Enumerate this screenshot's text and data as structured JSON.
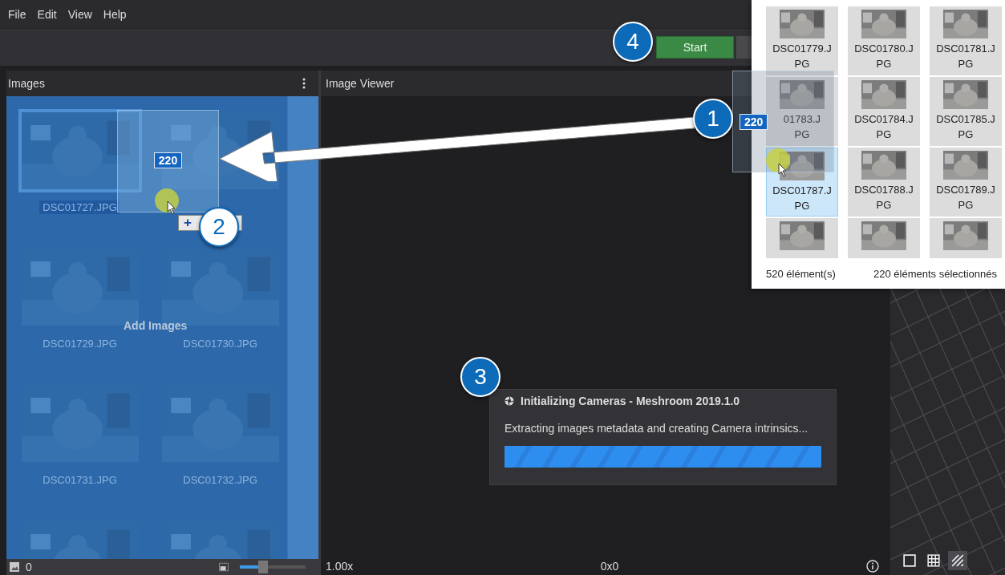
{
  "menu": [
    "File",
    "Edit",
    "View",
    "Help"
  ],
  "toolbar": {
    "start_button": "Start"
  },
  "images_panel": {
    "title": "Images",
    "drop_hint": "Add Images",
    "thumbnails": [
      {
        "label": "DSC01727.JPG",
        "selected": true
      },
      {
        "selected": false
      },
      {
        "label": "DSC01729.JPG",
        "selected": false
      },
      {
        "label": "DSC01730.JPG",
        "selected": false
      },
      {
        "label": "DSC01731.JPG",
        "selected": false
      },
      {
        "label": "DSC01732.JPG",
        "selected": false
      },
      {
        "selected": false
      },
      {
        "selected": false
      }
    ],
    "image_count": "0",
    "thumbnail_size": {
      "level": 0.35
    }
  },
  "drag_ghost": {
    "count": "220",
    "drop_symbol": "+"
  },
  "image_viewer": {
    "title": "Image Viewer",
    "zoom": "1.00x",
    "resolution": "0x0"
  },
  "progress_dialog": {
    "title": "Initializing Cameras - Meshroom 2019.1.0",
    "message": "Extracting images metadata and creating Camera intrinsics...",
    "level": 1
  },
  "viewer3d": {
    "view_modes": [
      {
        "kind": "single",
        "selected": false
      },
      {
        "kind": "grid",
        "selected": false
      },
      {
        "kind": "hatched",
        "selected": true
      }
    ]
  },
  "file_explorer": {
    "files": [
      {
        "name": "DSC01779.J\nPG",
        "selected": true
      },
      {
        "name": "DSC01780.J\nPG",
        "selected": true
      },
      {
        "name": "DSC01781.J\nPG",
        "selected": true
      },
      {
        "name": "01783.J\nPG",
        "selected": true
      },
      {
        "name": "DSC01784.J\nPG",
        "selected": true
      },
      {
        "name": "DSC01785.J\nPG",
        "selected": true
      },
      {
        "name": "DSC01787.J\nPG",
        "selected": true,
        "focused": true
      },
      {
        "name": "DSC01788.J\nPG",
        "selected": true
      },
      {
        "name": "DSC01789.J\nPG",
        "selected": true
      },
      {
        "selected": true
      },
      {
        "selected": true
      },
      {
        "selected": true
      }
    ],
    "drag_count": "220",
    "item_count": "520 élément(s)",
    "selection_count": "220 éléments sélectionnés"
  },
  "callouts": [
    "1",
    "2",
    "3",
    "4"
  ]
}
